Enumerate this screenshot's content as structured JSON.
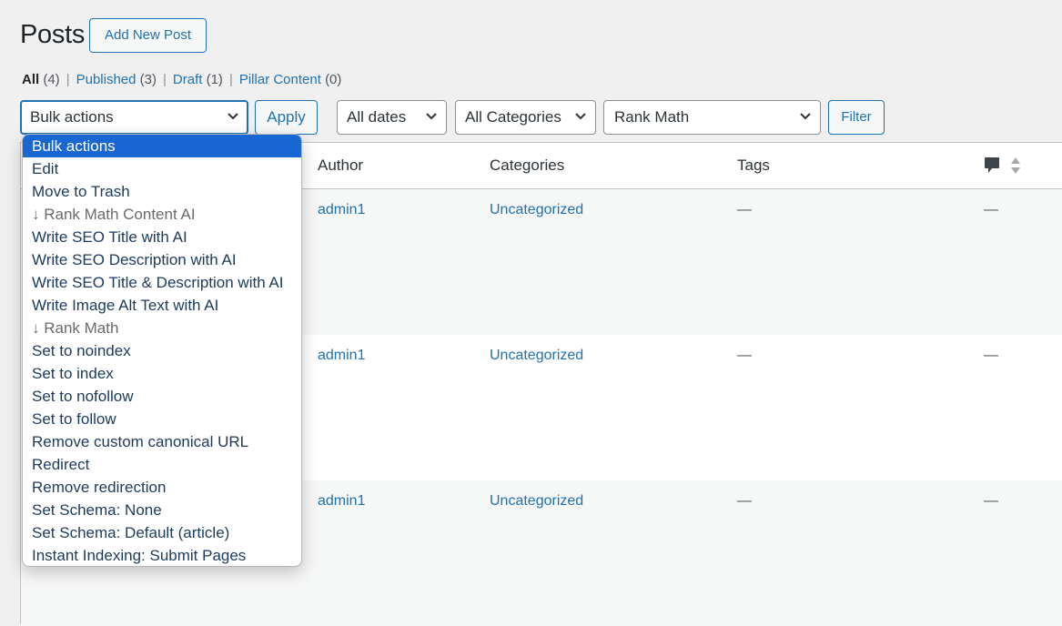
{
  "header": {
    "title": "Posts",
    "add_new_label": "Add New Post"
  },
  "views": [
    {
      "label": "All",
      "count": "(4)",
      "current": true
    },
    {
      "label": "Published",
      "count": "(3)",
      "current": false
    },
    {
      "label": "Draft",
      "count": "(1)",
      "current": false
    },
    {
      "label": "Pillar Content",
      "count": "(0)",
      "current": false
    }
  ],
  "toolbar": {
    "bulk_actions_value": "Bulk actions",
    "apply_label": "Apply",
    "dates_value": "All dates",
    "categories_value": "All Categories",
    "rank_math_value": "Rank Math",
    "filter_label": "Filter"
  },
  "bulk_actions_menu": {
    "options": [
      {
        "label": "Bulk actions",
        "selected": true,
        "group": false
      },
      {
        "label": "Edit",
        "selected": false,
        "group": false
      },
      {
        "label": "Move to Trash",
        "selected": false,
        "group": false
      },
      {
        "label": "↓ Rank Math Content AI",
        "selected": false,
        "group": true
      },
      {
        "label": "Write SEO Title with AI",
        "selected": false,
        "group": false
      },
      {
        "label": "Write SEO Description with AI",
        "selected": false,
        "group": false
      },
      {
        "label": "Write SEO Title & Description with AI",
        "selected": false,
        "group": false
      },
      {
        "label": "Write Image Alt Text with AI",
        "selected": false,
        "group": false
      },
      {
        "label": "↓ Rank Math",
        "selected": false,
        "group": true
      },
      {
        "label": "Set to noindex",
        "selected": false,
        "group": false
      },
      {
        "label": "Set to index",
        "selected": false,
        "group": false
      },
      {
        "label": "Set to nofollow",
        "selected": false,
        "group": false
      },
      {
        "label": "Set to follow",
        "selected": false,
        "group": false
      },
      {
        "label": "Remove custom canonical URL",
        "selected": false,
        "group": false
      },
      {
        "label": "Redirect",
        "selected": false,
        "group": false
      },
      {
        "label": "Remove redirection",
        "selected": false,
        "group": false
      },
      {
        "label": "Set Schema: None",
        "selected": false,
        "group": false
      },
      {
        "label": "Set Schema: Default (article)",
        "selected": false,
        "group": false
      },
      {
        "label": "Instant Indexing: Submit Pages",
        "selected": false,
        "group": false
      }
    ]
  },
  "table": {
    "columns": {
      "author": "Author",
      "categories": "Categories",
      "tags": "Tags",
      "comments_icon": "comment-icon",
      "sort_icon": "sort-arrows-icon"
    },
    "rows": [
      {
        "author": "admin1",
        "categories": "Uncategorized",
        "tags": "—",
        "comments": "—"
      },
      {
        "author": "admin1",
        "categories": "Uncategorized",
        "tags": "—",
        "comments": "—"
      },
      {
        "author": "admin1",
        "categories": "Uncategorized",
        "tags": "—",
        "comments": "—"
      }
    ]
  },
  "colors": {
    "accent": "#2271b1",
    "selected_option": "#1a66d2",
    "page_bg": "#f0f0f1",
    "row_alt_bg": "#f6f7f7"
  }
}
